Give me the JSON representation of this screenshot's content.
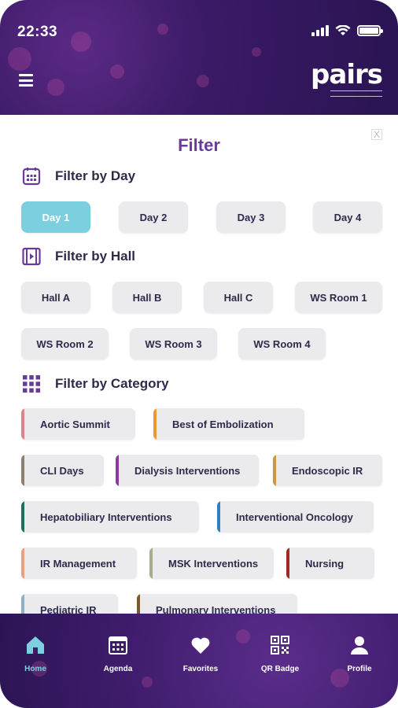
{
  "status_bar": {
    "time": "22:33"
  },
  "header": {
    "logo_text": "pairs"
  },
  "filter": {
    "title": "Filter",
    "close_label": "X",
    "day_section": {
      "label": "Filter by Day",
      "options": [
        "Day 1",
        "Day 2",
        "Day 3",
        "Day 4"
      ],
      "selected": "Day 1"
    },
    "hall_section": {
      "label": "Filter by Hall",
      "options": [
        "Hall A",
        "Hall B",
        "Hall C",
        "WS Room 1",
        "WS Room 2",
        "WS Room 3",
        "WS Room 4"
      ]
    },
    "category_section": {
      "label": "Filter by Category",
      "options": [
        {
          "label": "Aortic Summit",
          "color": "#d9848f"
        },
        {
          "label": "Best of Embolization",
          "color": "#e89a2f"
        },
        {
          "label": "CLI Days",
          "color": "#8a7f70"
        },
        {
          "label": "Dialysis Interventions",
          "color": "#8a3c9c"
        },
        {
          "label": "Endoscopic IR",
          "color": "#c99a3e"
        },
        {
          "label": "Hepatobiliary Interventions",
          "color": "#1e6e5a"
        },
        {
          "label": "Interventional Oncology",
          "color": "#2f7fc2"
        },
        {
          "label": "IR Management",
          "color": "#e7a184"
        },
        {
          "label": "MSK Interventions",
          "color": "#a9ac8a"
        },
        {
          "label": "Nursing",
          "color": "#a02a22"
        },
        {
          "label": "Pediatric IR",
          "color": "#8fb0c2"
        },
        {
          "label": "Pulmonary Interventions",
          "color": "#7a5a2a"
        }
      ]
    }
  },
  "tabbar": {
    "items": [
      {
        "label": "Home",
        "icon": "home-icon",
        "active": true
      },
      {
        "label": "Agenda",
        "icon": "calendar-icon",
        "active": false
      },
      {
        "label": "Favorites",
        "icon": "heart-icon",
        "active": false
      },
      {
        "label": "QR Badge",
        "icon": "qr-code-icon",
        "active": false
      },
      {
        "label": "Profile",
        "icon": "user-icon",
        "active": false
      }
    ]
  },
  "colors": {
    "accent": "#7ccfdf",
    "brand_purple": "#6a3c9a",
    "chip_bg": "#ebebee"
  }
}
